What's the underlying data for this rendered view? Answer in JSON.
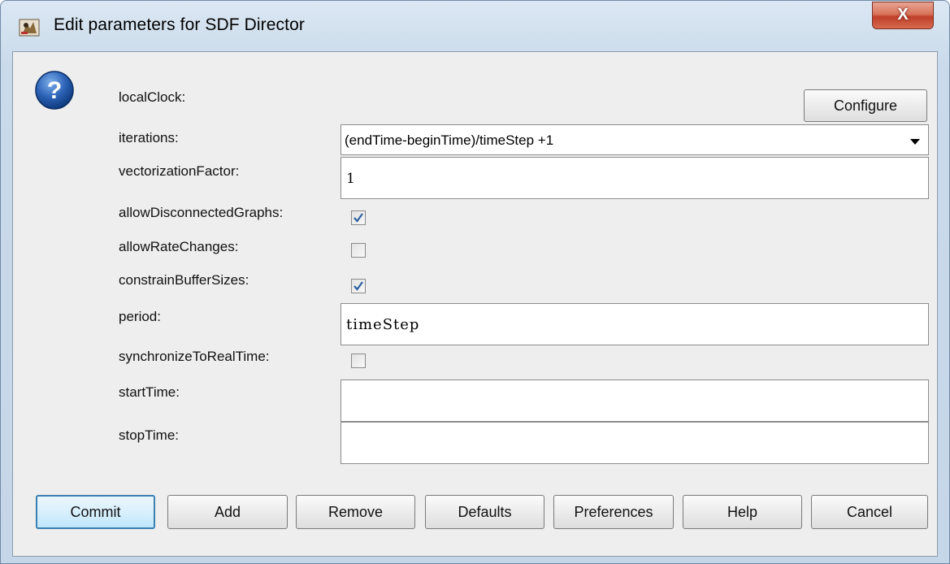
{
  "window": {
    "title": "Edit parameters for SDF Director",
    "close_label": "X"
  },
  "fields": {
    "localClock": {
      "label": "localClock:"
    },
    "configure_label": "Configure",
    "iterations": {
      "label": "iterations:",
      "value": "(endTime-beginTime)/timeStep +1"
    },
    "vectorizationFactor": {
      "label": "vectorizationFactor:",
      "value": "1"
    },
    "allowDisconnectedGraphs": {
      "label": "allowDisconnectedGraphs:",
      "checked": true
    },
    "allowRateChanges": {
      "label": "allowRateChanges:",
      "checked": false
    },
    "constrainBufferSizes": {
      "label": "constrainBufferSizes:",
      "checked": true
    },
    "period": {
      "label": "period:",
      "value": "timeStep"
    },
    "synchronizeToRealTime": {
      "label": "synchronizeToRealTime:",
      "checked": false
    },
    "startTime": {
      "label": "startTime:",
      "value": ""
    },
    "stopTime": {
      "label": "stopTime:",
      "value": ""
    }
  },
  "buttons": {
    "commit": "Commit",
    "add": "Add",
    "remove": "Remove",
    "defaults": "Defaults",
    "preferences": "Preferences",
    "help": "Help",
    "cancel": "Cancel"
  },
  "colors": {
    "accent": "#3c7fb1",
    "close": "#c0402a",
    "check": "#2a5f9e"
  },
  "icons": {
    "app": "ptolemy-app-icon",
    "question": "question-icon",
    "close": "close-icon",
    "dropdown": "chevron-down-icon",
    "check": "checkmark-icon"
  }
}
